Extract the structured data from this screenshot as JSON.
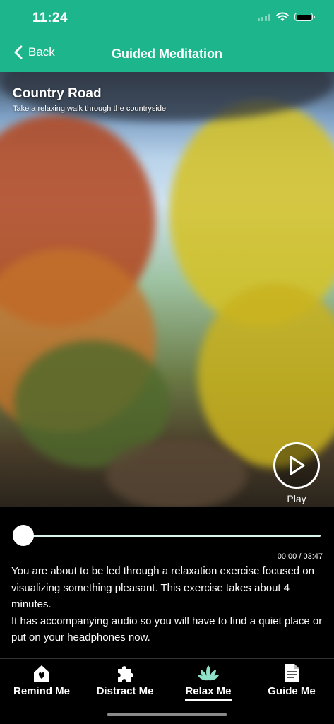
{
  "status_bar": {
    "time": "11:24"
  },
  "header": {
    "back_label": "Back",
    "title": "Guided Meditation",
    "background": "#1db58c"
  },
  "track": {
    "title": "Country Road",
    "subtitle": "Take a relaxing walk through the countryside",
    "play_label": "Play",
    "time_display": "00:00 / 03:47",
    "progress": 0
  },
  "description": {
    "paragraphs": [
      "You are about to be led through a relaxation exercise focused on visualizing something pleasant. This exercise takes about 4 minutes.",
      "It has accompanying audio so you will have to find a quiet place or put on your headphones now."
    ]
  },
  "tabs": [
    {
      "label": "Remind Me",
      "icon": "home-heart-icon",
      "active": false
    },
    {
      "label": "Distract Me",
      "icon": "puzzle-icon",
      "active": false
    },
    {
      "label": "Relax Me",
      "icon": "lotus-icon",
      "active": true
    },
    {
      "label": "Guide Me",
      "icon": "document-icon",
      "active": false
    }
  ],
  "colors": {
    "accent": "#1db58c",
    "lotus": "#8fe0c8"
  }
}
